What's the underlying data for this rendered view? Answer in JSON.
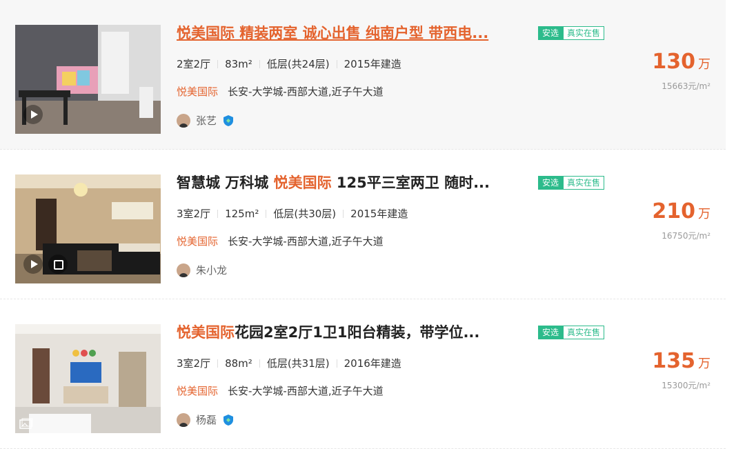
{
  "listings": [
    {
      "title_parts": [
        {
          "text": "悦美国际",
          "kw": true
        },
        {
          "text": " 精装两室 诚心出售 纯南户型 带西电...",
          "kw": false
        }
      ],
      "tag_a": "安选",
      "tag_b": "真实在售",
      "rooms": "2室2厅",
      "area": "83m²",
      "floor": "低层(共24层)",
      "year": "2015年建造",
      "community": "悦美国际",
      "location": "长安-大学城-西部大道,近子午大道",
      "agent": "张艺",
      "verified": true,
      "price": "130",
      "price_unit": "万",
      "unit_price": "15663元/m²",
      "media": [
        "play"
      ]
    },
    {
      "title_parts": [
        {
          "text": "智慧城 万科城 ",
          "kw": false
        },
        {
          "text": "悦美国际",
          "kw": true
        },
        {
          "text": " 125平三室两卫 随时...",
          "kw": false
        }
      ],
      "tag_a": "安选",
      "tag_b": "真实在售",
      "rooms": "3室2厅",
      "area": "125m²",
      "floor": "低层(共30层)",
      "year": "2015年建造",
      "community": "悦美国际",
      "location": "长安-大学城-西部大道,近子午大道",
      "agent": "朱小龙",
      "verified": false,
      "price": "210",
      "price_unit": "万",
      "unit_price": "16750元/m²",
      "media": [
        "play",
        "vr"
      ]
    },
    {
      "title_parts": [
        {
          "text": "悦美国际",
          "kw": true
        },
        {
          "text": "花园2室2厅1卫1阳台精装，带学位...",
          "kw": false
        }
      ],
      "tag_a": "安选",
      "tag_b": "真实在售",
      "rooms": "3室2厅",
      "area": "88m²",
      "floor": "低层(共31层)",
      "year": "2016年建造",
      "community": "悦美国际",
      "location": "长安-大学城-西部大道,近子午大道",
      "agent": "杨磊",
      "verified": true,
      "price": "135",
      "price_unit": "万",
      "unit_price": "15300元/m²",
      "media": [
        "pic"
      ]
    }
  ],
  "colors": {
    "accent": "#e4632e",
    "tag_green": "#2cbb8b",
    "shield_blue": "#1f8fe0"
  }
}
